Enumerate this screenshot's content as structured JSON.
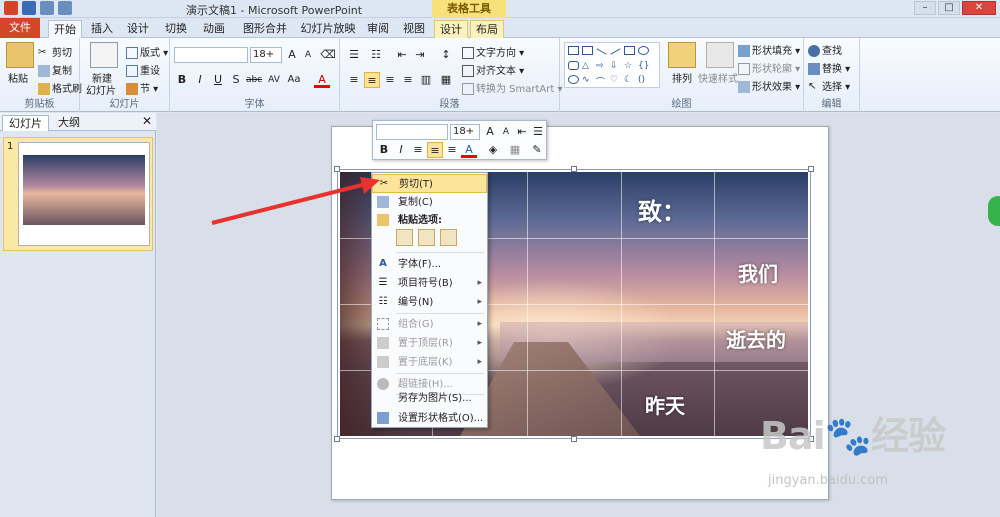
{
  "window": {
    "title": "演示文稿1 - Microsoft PowerPoint",
    "context_tool_header": "表格工具"
  },
  "tabs": [
    "文件",
    "开始",
    "插入",
    "设计",
    "切换",
    "动画",
    "图形合并",
    "幻灯片放映",
    "审阅",
    "视图",
    "设计",
    "布局"
  ],
  "ribbon": {
    "clipboard": {
      "paste": "粘贴",
      "cut": "剪切",
      "copy": "复制",
      "format_painter": "格式刷",
      "label": "剪贴板"
    },
    "slides": {
      "new_slide": "新建",
      "new_slide2": "幻灯片",
      "layout": "版式",
      "reset": "重设",
      "section": "节",
      "label": "幻灯片"
    },
    "font": {
      "size": "18+",
      "label": "字体"
    },
    "paragraph": {
      "text_direction": "文字方向",
      "align_text": "对齐文本",
      "smartart": "转换为 SmartArt",
      "label": "段落"
    },
    "drawing": {
      "arrange": "排列",
      "quick_styles": "快速样式",
      "shape_fill": "形状填充",
      "shape_outline": "形状轮廓",
      "shape_effects": "形状效果",
      "label": "绘图"
    },
    "editing": {
      "find": "查找",
      "replace": "替换",
      "select": "选择",
      "label": "编辑"
    }
  },
  "left_panel": {
    "tab_slides": "幻灯片",
    "tab_outline": "大纲",
    "slide_number": "1"
  },
  "mini_toolbar": {
    "font_size": "18+"
  },
  "context_menu": {
    "cut": "剪切(T)",
    "copy": "复制(C)",
    "paste_options": "粘贴选项:",
    "font": "字体(F)...",
    "bullets": "项目符号(B)",
    "numbering": "编号(N)",
    "group": "组合(G)",
    "bring_front": "置于顶层(R)",
    "send_back": "置于底层(K)",
    "hyperlink": "超链接(H)...",
    "save_as_picture": "另存为图片(S)...",
    "format_shape": "设置形状格式(O)..."
  },
  "slide_text": {
    "line1": "致：",
    "line2": "我们",
    "line3": "逝去的",
    "line4": "昨天"
  },
  "watermark": {
    "brand": "Bai",
    "brand2": "经验",
    "url": "jingyan.baidu.com"
  },
  "colors": {
    "file_tab": "#d24726",
    "highlight": "#fde49b",
    "arrow": "#e8322e"
  }
}
